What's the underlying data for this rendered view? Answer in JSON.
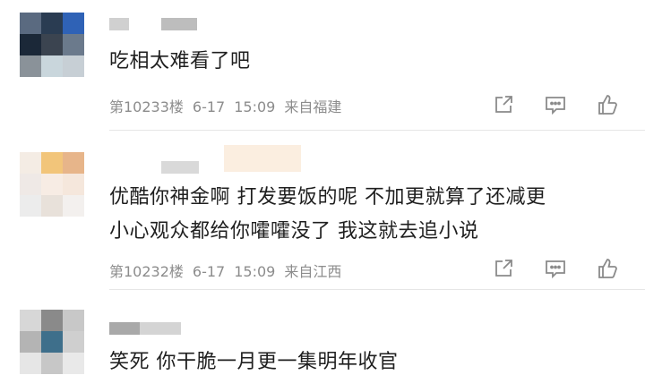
{
  "comments": [
    {
      "text_lines": [
        "吃相太难看了吧"
      ],
      "floor": "第10233楼",
      "date": "6-17",
      "time": "15:09",
      "location": "来自福建",
      "avatar_colors": [
        "#5a6a80",
        "#2a3c52",
        "#2f62b6",
        "#1b2838",
        "#3b4450",
        "#6b7a8c",
        "#8a9299",
        "#c9d6dc",
        "#c7cfd5"
      ],
      "name_colors": [
        "#cfcfcf",
        "#bdbdbd"
      ]
    },
    {
      "text_lines": [
        "优酷你神金啊 打发要饭的呢 不加更就算了还减更",
        "小心观众都给你嚯嚯没了 我这就去追小说"
      ],
      "floor": "第10232楼",
      "date": "6-17",
      "time": "15:09",
      "location": "来自江西",
      "avatar_colors": [
        "#f4ece4",
        "#f2c57a",
        "#e7b58a",
        "#efe9e6",
        "#f7ece4",
        "#f5e7dc",
        "#ececec",
        "#e8e1da",
        "#f3f0ee"
      ],
      "name_colors": [
        "#d9d9d9",
        "#fbeee0"
      ]
    },
    {
      "text_lines": [
        "笑死 你干脆一月更一集明年收官"
      ],
      "avatar_colors": [
        "#d7d7d7",
        "#8a8a8a",
        "#c8c8c8",
        "#b4b4b4",
        "#3e6f8b",
        "#cfcfcf",
        "#e6e6e6",
        "#c7c7c7",
        "#e9e9e9"
      ],
      "name_colors": [
        "#a9a9a9",
        "#d4d4d4"
      ]
    }
  ],
  "icons": [
    "share-icon",
    "reply-icon",
    "like-icon"
  ]
}
